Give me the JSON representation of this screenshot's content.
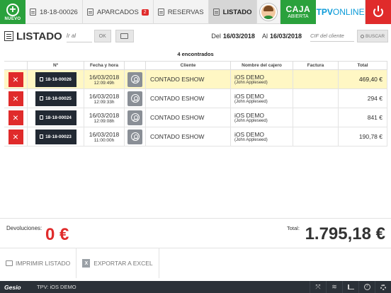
{
  "topbar": {
    "new_label": "NUEVO",
    "ticket_label": "18-18-00026",
    "aparcados_label": "APARCADOS",
    "aparcados_count": "2",
    "reservas_label": "RESERVAS",
    "listado_label": "LISTADO",
    "caja_line1": "CAJA",
    "caja_line2": "ABIERTA",
    "logo_tpv": "TPV",
    "logo_online": "ONLINE",
    "accent_green": "#2aa13c",
    "accent_red": "#e02b2b"
  },
  "toolbar": {
    "title": "LISTADO",
    "goto_placeholder": "Ir al",
    "ok_label": "OK",
    "from_label": "Del",
    "from_date": "16/03/2018",
    "to_label": "Al",
    "to_date": "16/03/2018",
    "cif_placeholder": "CIF del cliente",
    "search_label": "BUSCAR"
  },
  "grid": {
    "found_text": "4 encontrados",
    "headers": {
      "num": "Nº",
      "date": "Fecha y hora",
      "client": "Cliente",
      "cashier": "Nombre del cajero",
      "invoice": "Factura",
      "total": "Total"
    },
    "rows": [
      {
        "num": "18-18-00026",
        "date": "16/03/2018",
        "time": "12:09:49h",
        "client": "CONTADO ESHOW",
        "cashier": "iOS DEMO",
        "cashier_sub": "(John Appleseed)",
        "invoice": "",
        "total": "469,40 €"
      },
      {
        "num": "18-18-00025",
        "date": "16/03/2018",
        "time": "12:09:33h",
        "client": "CONTADO ESHOW",
        "cashier": "iOS DEMO",
        "cashier_sub": "(John Appleseed)",
        "invoice": "",
        "total": "294 €"
      },
      {
        "num": "18-18-00024",
        "date": "16/03/2018",
        "time": "12:09:08h",
        "client": "CONTADO ESHOW",
        "cashier": "iOS DEMO",
        "cashier_sub": "(John Appleseed)",
        "invoice": "",
        "total": "841 €"
      },
      {
        "num": "18-18-00023",
        "date": "16/03/2018",
        "time": "11:00:00h",
        "client": "CONTADO ESHOW",
        "cashier": "iOS DEMO",
        "cashier_sub": "(John Appleseed)",
        "invoice": "",
        "total": "190,78 €"
      }
    ]
  },
  "summary": {
    "returns_label": "Devoluciones:",
    "returns_value": "0 €",
    "total_label": "Total:",
    "total_value": "1.795,18 €"
  },
  "actions": {
    "print_label": "IMPRIMIR LISTADO",
    "export_label": "EXPORTAR A EXCEL"
  },
  "statusbar": {
    "brand": "Gesio",
    "tpv_label": "TPV: iOS DEMO"
  }
}
